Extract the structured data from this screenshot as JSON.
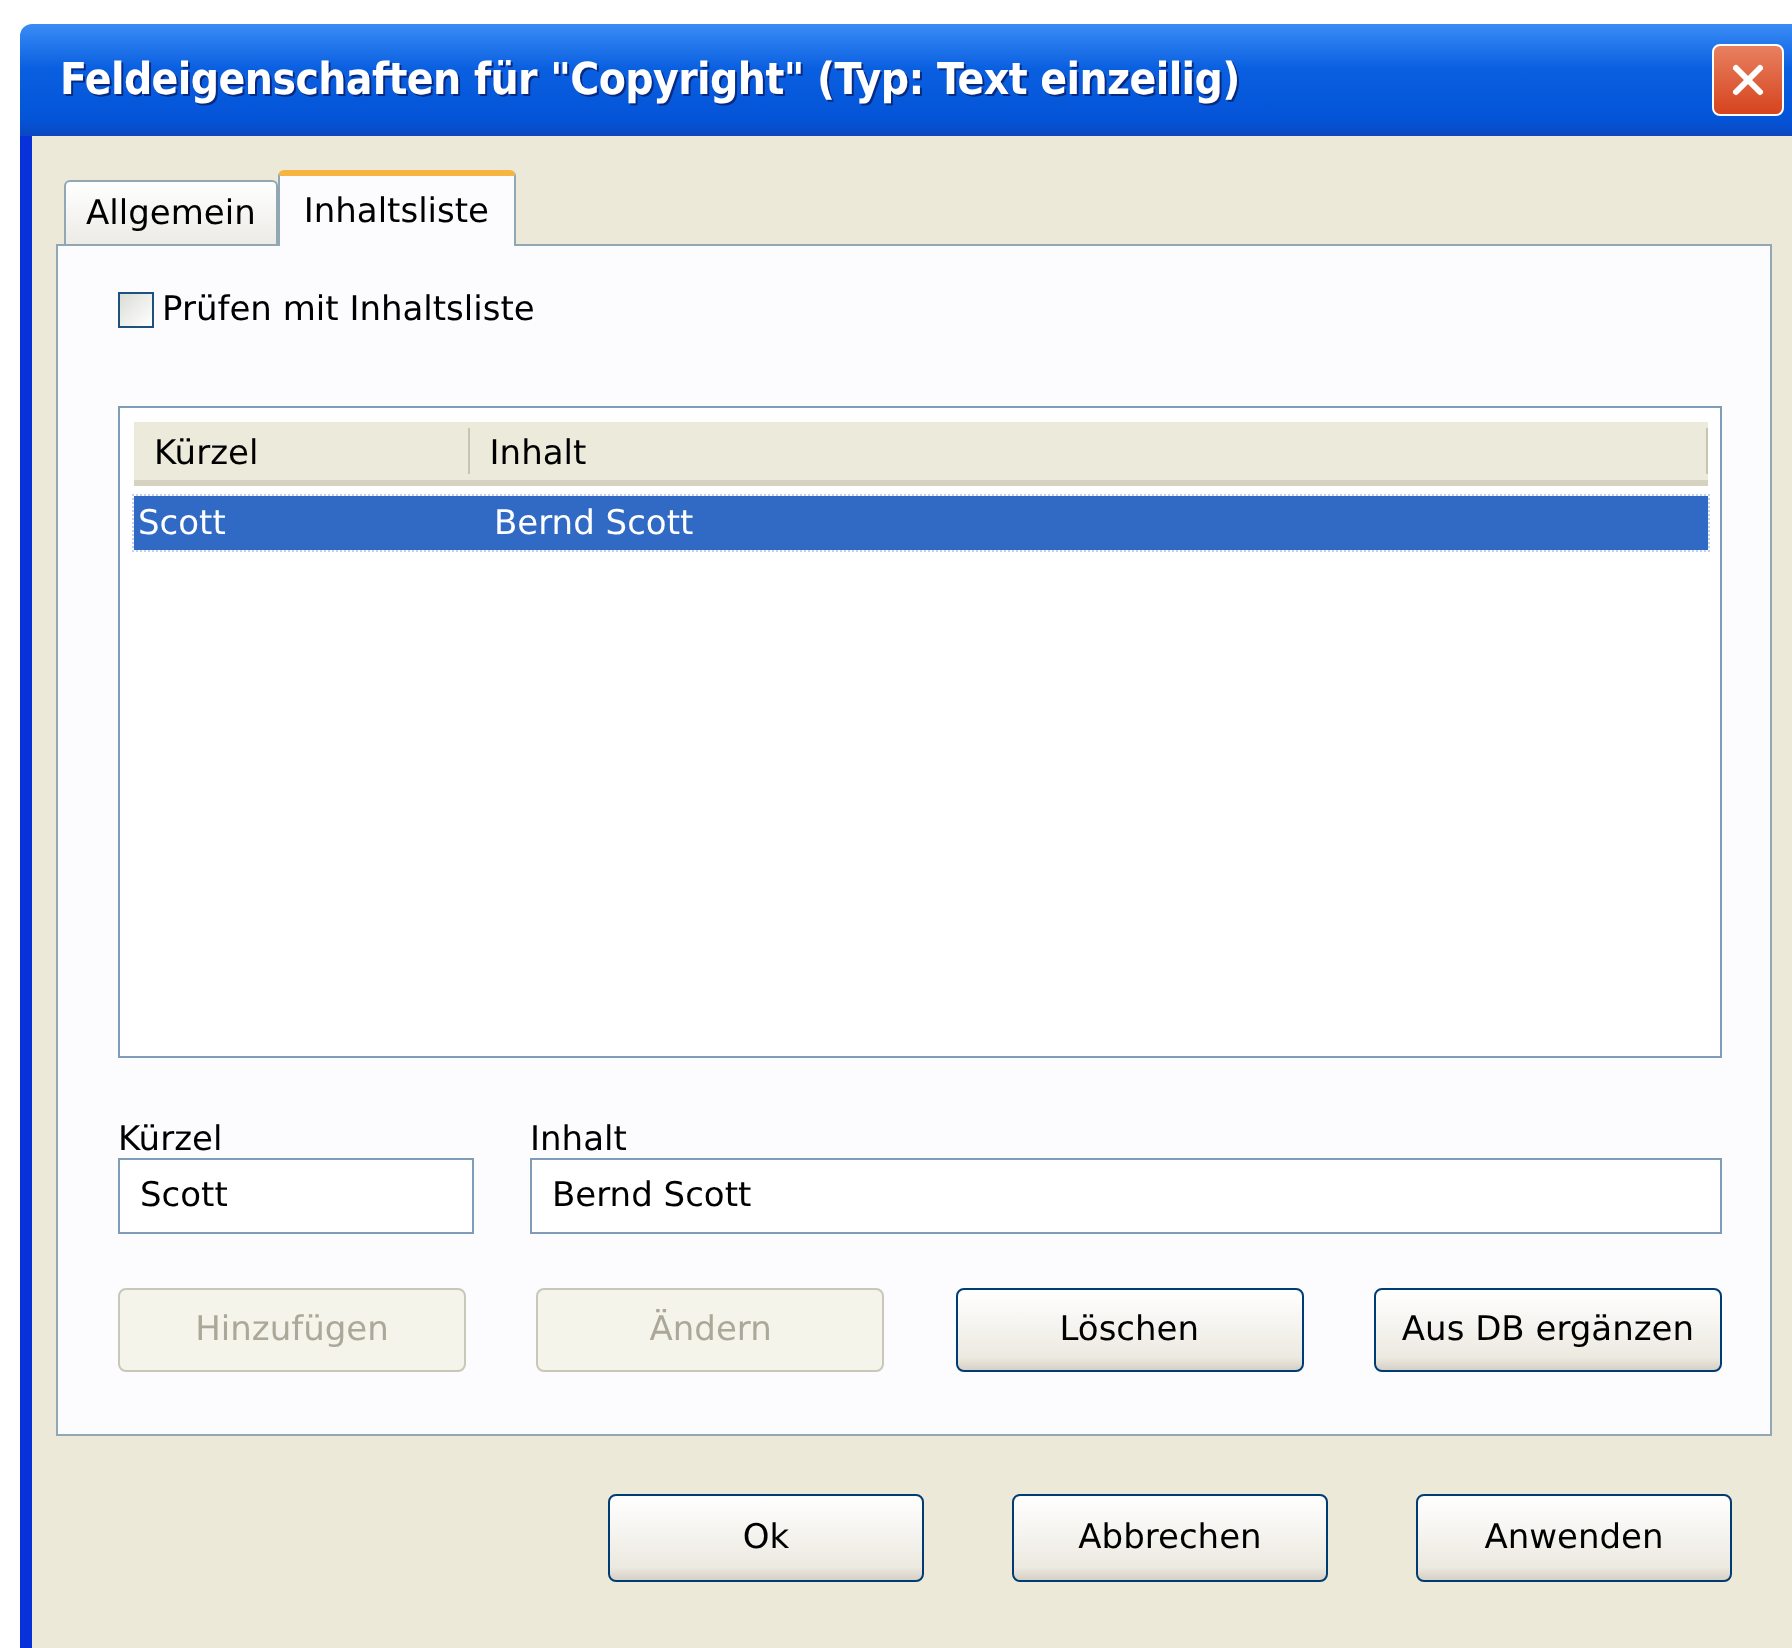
{
  "window": {
    "title": "Feldeigenschaften für \"Copyright\" (Typ: Text einzeilig)"
  },
  "tabs": [
    {
      "label": "Allgemein",
      "selected": false
    },
    {
      "label": "Inhaltsliste",
      "selected": true
    }
  ],
  "checkbox": {
    "label": "Prüfen mit Inhaltsliste",
    "checked": false
  },
  "list": {
    "columns": [
      "Kürzel",
      "Inhalt"
    ],
    "rows": [
      {
        "cells": [
          "Scott",
          "Bernd Scott"
        ],
        "selected": true
      }
    ]
  },
  "fields": [
    {
      "label": "Kürzel",
      "value": "Scott"
    },
    {
      "label": "Inhalt",
      "value": "Bernd Scott"
    }
  ],
  "action_buttons": [
    {
      "label": "Hinzufügen",
      "disabled": true
    },
    {
      "label": "Ändern",
      "disabled": true
    },
    {
      "label": "Löschen",
      "disabled": false
    },
    {
      "label": "Aus DB ergänzen",
      "disabled": false
    }
  ],
  "dialog_buttons": [
    {
      "label": "Ok"
    },
    {
      "label": "Abbrechen"
    },
    {
      "label": "Anwenden"
    }
  ]
}
